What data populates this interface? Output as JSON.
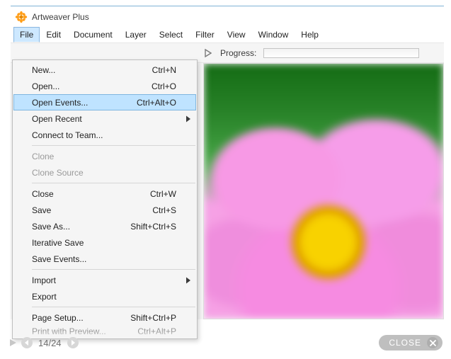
{
  "app": {
    "title": "Artweaver Plus"
  },
  "menubar": [
    "File",
    "Edit",
    "Document",
    "Layer",
    "Select",
    "Filter",
    "View",
    "Window",
    "Help"
  ],
  "toolbar": {
    "progress_label": "Progress:"
  },
  "file_menu": {
    "items": [
      {
        "label": "New...",
        "accel": "Ctrl+N",
        "enabled": true,
        "submenu": false
      },
      {
        "label": "Open...",
        "accel": "Ctrl+O",
        "enabled": true,
        "submenu": false
      },
      {
        "label": "Open Events...",
        "accel": "Ctrl+Alt+O",
        "enabled": true,
        "submenu": false,
        "highlight": true
      },
      {
        "label": "Open Recent",
        "accel": "",
        "enabled": true,
        "submenu": true
      },
      {
        "label": "Connect to Team...",
        "accel": "",
        "enabled": true,
        "submenu": false
      },
      {
        "sep": true
      },
      {
        "label": "Clone",
        "accel": "",
        "enabled": false,
        "submenu": false
      },
      {
        "label": "Clone Source",
        "accel": "",
        "enabled": false,
        "submenu": false
      },
      {
        "sep": true
      },
      {
        "label": "Close",
        "accel": "Ctrl+W",
        "enabled": true,
        "submenu": false
      },
      {
        "label": "Save",
        "accel": "Ctrl+S",
        "enabled": true,
        "submenu": false
      },
      {
        "label": "Save As...",
        "accel": "Shift+Ctrl+S",
        "enabled": true,
        "submenu": false
      },
      {
        "label": "Iterative Save",
        "accel": "",
        "enabled": true,
        "submenu": false
      },
      {
        "label": "Save Events...",
        "accel": "",
        "enabled": true,
        "submenu": false
      },
      {
        "sep": true
      },
      {
        "label": "Import",
        "accel": "",
        "enabled": true,
        "submenu": true
      },
      {
        "label": "Export",
        "accel": "",
        "enabled": true,
        "submenu": false
      },
      {
        "sep": true
      },
      {
        "label": "Page Setup...",
        "accel": "Shift+Ctrl+P",
        "enabled": true,
        "submenu": false
      },
      {
        "label": "Print with Preview...",
        "accel": "Ctrl+Alt+P",
        "enabled": false,
        "submenu": false
      }
    ]
  },
  "footer": {
    "page": "14/24",
    "close_label": "CLOSE"
  }
}
